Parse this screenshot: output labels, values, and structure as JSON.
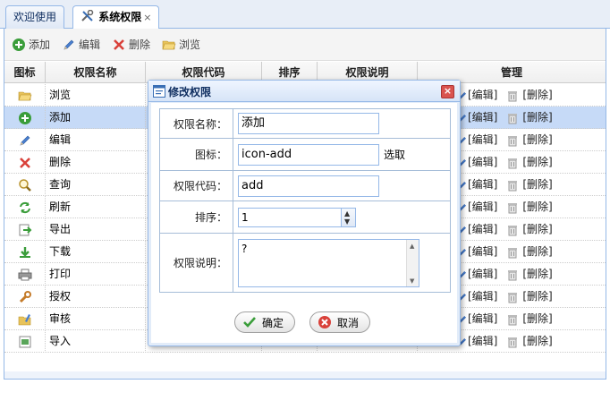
{
  "tabs": [
    {
      "label": "欢迎使用",
      "active": false
    },
    {
      "label": "系统权限",
      "active": true,
      "close": "×"
    }
  ],
  "toolbar": {
    "add": "添加",
    "edit": "编辑",
    "delete": "删除",
    "browse": "浏览"
  },
  "grid": {
    "headers": {
      "icon": "图标",
      "name": "权限名称",
      "code": "权限代码",
      "order": "排序",
      "desc": "权限说明",
      "manage": "管理"
    },
    "edit_label": "[编辑]",
    "delete_label": "[删除]",
    "rows": [
      {
        "icon": "folder-open-icon",
        "name": "浏览"
      },
      {
        "icon": "add-icon",
        "name": "添加"
      },
      {
        "icon": "pencil-icon",
        "name": "编辑"
      },
      {
        "icon": "delete-x-icon",
        "name": "删除"
      },
      {
        "icon": "search-icon",
        "name": "查询"
      },
      {
        "icon": "refresh-icon",
        "name": "刷新"
      },
      {
        "icon": "export-icon",
        "name": "导出"
      },
      {
        "icon": "download-icon",
        "name": "下载"
      },
      {
        "icon": "print-icon",
        "name": "打印"
      },
      {
        "icon": "wrench-icon",
        "name": "授权"
      },
      {
        "icon": "audit-folder-icon",
        "name": "审核"
      },
      {
        "icon": "import-icon",
        "name": "导入"
      }
    ],
    "selected_row": 1
  },
  "modal": {
    "title": "修改权限",
    "close": "×",
    "fields": {
      "name_label": "权限名称：",
      "name_value": "添加",
      "icon_label": "图标：",
      "icon_value": "icon-add",
      "icon_choose": "选取",
      "code_label": "权限代码：",
      "code_value": "add",
      "order_label": "排序：",
      "order_value": "1",
      "desc_label": "权限说明：",
      "desc_value": "?"
    },
    "ok": "确定",
    "cancel": "取消"
  },
  "colors": {
    "border_blue": "#95b8e7",
    "selected_row": "#c6daf7",
    "title_text": "#0e2d5f"
  }
}
